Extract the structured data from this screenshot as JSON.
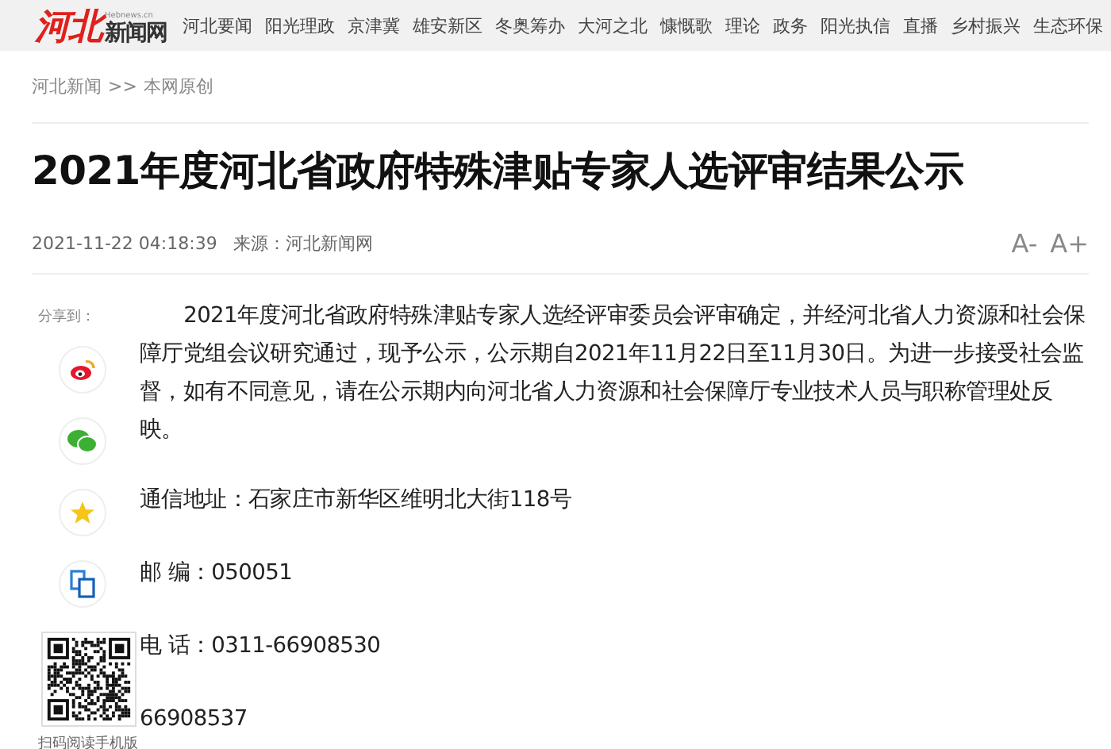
{
  "header": {
    "logo": {
      "mark": "河北",
      "domain": "Hebnews.cn",
      "name": "新闻网"
    },
    "nav": [
      "河北要闻",
      "阳光理政",
      "京津冀",
      "雄安新区",
      "冬奥筹办",
      "大河之北",
      "慷慨歌",
      "理论",
      "政务",
      "阳光执信",
      "直播",
      "乡村振兴",
      "生态环保"
    ]
  },
  "breadcrumb": {
    "home": "河北新闻",
    "separator": ">>",
    "current": "本网原创"
  },
  "article": {
    "title": "2021年度河北省政府特殊津贴专家人选评审结果公示",
    "datetime": "2021-11-22 04:18:39",
    "source": "来源：河北新闻网",
    "font_buttons": [
      "A-",
      "A+"
    ],
    "paragraphs": [
      {
        "kind": "indent",
        "text": "2021年度河北省政府特殊津贴专家人选经评审委员会评审确定，并经河北省人力资源和社会保障厅党组会议研究通过，现予公示，公示期自2021年11月22日至11月30日。为进一步接受社会监督，如有不同意见，请在公示期内向河北省人力资源和社会保障厅专业技术人员与职称管理处反映。"
      },
      {
        "kind": "line",
        "text": "通信地址：石家庄市新华区维明北大街118号"
      },
      {
        "kind": "line",
        "text": "邮 编：050051"
      },
      {
        "kind": "line",
        "text": "电 话：0311-66908530"
      },
      {
        "kind": "line",
        "text": "66908537"
      }
    ]
  },
  "share": {
    "label": "分享到：",
    "buttons": [
      {
        "kind": "weibo"
      },
      {
        "kind": "wechat"
      },
      {
        "kind": "favorite"
      },
      {
        "kind": "copy"
      }
    ],
    "qr_caption": "扫码阅读手机版"
  }
}
